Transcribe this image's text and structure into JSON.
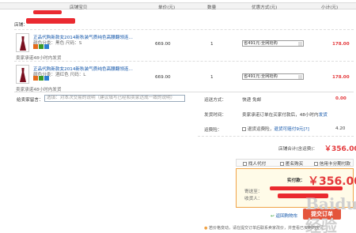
{
  "header": {
    "shop_label": "店铺宝贝",
    "price_label": "单价(元)",
    "qty_label": "数量",
    "promo_label": "优惠方式(元)",
    "subtotal_label": "小计(元)"
  },
  "shop": {
    "label": "店铺："
  },
  "items": [
    {
      "title": "正品代购新款女2014新秋装气质纯色高腰翻领连...",
      "spec": "颜色分类：黑色   尺码：S",
      "service": "卖家承诺48小时内发货",
      "price": "669.00",
      "qty": "1",
      "promo": "省491元:全网抢购",
      "subtotal": "178.00",
      "subtotal_color": "#e4393c"
    },
    {
      "title": "正品代购新款女2014新秋装气质纯色高腰翻领连...",
      "spec": "颜色分类：酒红色   尺码：L",
      "service": "卖家承诺48小时内发货",
      "price": "669.00",
      "qty": "1",
      "promo": "省491元:全网抢购",
      "subtotal": "178.00",
      "subtotal_color": "#e4393c"
    }
  ],
  "message": {
    "label": "给卖家留言：",
    "placeholder": "选填：对本次交易的说明（建议填写已经和卖家达成一致的说明）"
  },
  "delivery": {
    "label": "运送方式：",
    "value": "快递 免邮",
    "amount": "0.00"
  },
  "ship_time": {
    "label": "发货时间：",
    "value": "卖家承诺订单在买家付款后，48小时内",
    "link": "发货"
  },
  "insurance": {
    "label": "运费险：",
    "value": "退货运费险，",
    "link": "退货可赔付9元",
    "tip": "[?]",
    "amount": "4.20"
  },
  "store_total": {
    "label": "店铺合计(含运费)：",
    "value": "￥356.00"
  },
  "options": {
    "agent_pay": "找人代付",
    "anonymous": "匿名购买",
    "credit_card": "信用卡分期付款"
  },
  "payment": {
    "label": "实付款：",
    "value": "￥356.00",
    "address_label": "寄送至：",
    "receiver_label": "收货人："
  },
  "back_link": "返回购物车",
  "submit_label": "提交订单",
  "notice": "若价格变动，请在提交订单后联系卖家改价，并查看已买到的宝贝",
  "watermark": "Baidu 经验",
  "colors": {
    "accent": "#e4393c",
    "link": "#1155aa",
    "border": "#f0a347"
  }
}
